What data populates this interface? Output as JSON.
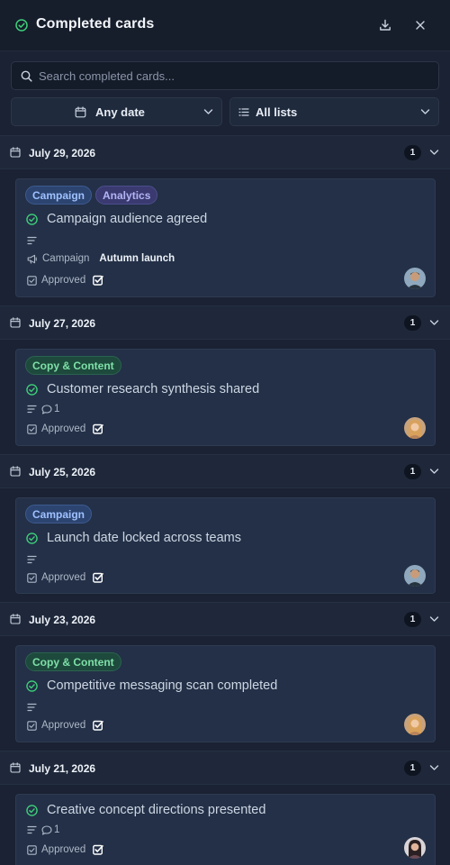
{
  "header": {
    "title": "Completed cards",
    "download_icon": "download-icon",
    "close_icon": "close-icon"
  },
  "search": {
    "placeholder": "Search completed cards..."
  },
  "filters": {
    "date": "Any date",
    "lists": "All lists"
  },
  "colors": {
    "background": "#1a2233",
    "card": "#233047",
    "success": "#3ecf7a",
    "tag_blue": "#9ec1ff",
    "tag_purple": "#b3b4f5",
    "tag_green": "#7fe0a8"
  },
  "groups": [
    {
      "date": "July 29, 2026",
      "count": "1",
      "card": {
        "tags": [
          "Campaign",
          "Analytics"
        ],
        "title": "Campaign audience agreed",
        "field_label": "Campaign",
        "field_value": "Autumn launch",
        "status": "Approved"
      }
    },
    {
      "date": "July 27, 2026",
      "count": "1",
      "card": {
        "tags": [
          "Copy & Content"
        ],
        "title": "Customer research synthesis shared",
        "comments": "1",
        "status": "Approved"
      }
    },
    {
      "date": "July 25, 2026",
      "count": "1",
      "card": {
        "tags": [
          "Campaign"
        ],
        "title": "Launch date locked across teams",
        "status": "Approved"
      }
    },
    {
      "date": "July 23, 2026",
      "count": "1",
      "card": {
        "tags": [
          "Copy & Content"
        ],
        "title": "Competitive messaging scan completed",
        "status": "Approved"
      }
    },
    {
      "date": "July 21, 2026",
      "count": "1",
      "card": {
        "title": "Creative concept directions presented",
        "comments": "1",
        "status": "Approved"
      }
    }
  ]
}
